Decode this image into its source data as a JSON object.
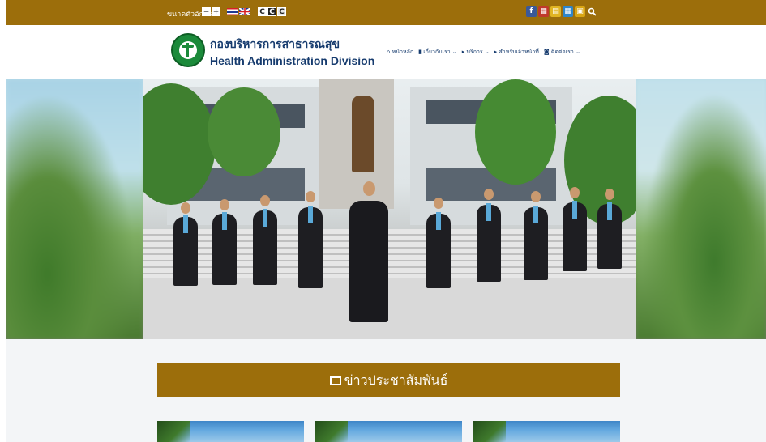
{
  "topbar": {
    "font_size_label": "ขนาดตัวอักษร",
    "font_decrease": "−",
    "font_increase": "+",
    "contrast_buttons": [
      "C",
      "C",
      "C"
    ],
    "social_icons": [
      "facebook-icon",
      "calendar-icon",
      "folder-icon",
      "grid-icon",
      "lock-icon",
      "search-icon"
    ]
  },
  "brand": {
    "title_th": "กองบริหารการสาธารณสุข",
    "title_en": "Health Administration Division"
  },
  "nav": [
    {
      "label": "หน้าหลัก",
      "icon": "home-icon"
    },
    {
      "label": "เกี่ยวกับเรา",
      "icon": "bookmark-icon",
      "dropdown": true
    },
    {
      "label": "บริการ",
      "icon": "caret-icon",
      "dropdown": true
    },
    {
      "label": "สำหรับเจ้าหน้าที่",
      "icon": "caret-icon"
    },
    {
      "label": "ติดต่อเรา",
      "icon": "chat-icon",
      "dropdown": true
    }
  ],
  "section": {
    "title": "ข่าวประชาสัมพันธ์"
  },
  "colors": {
    "brand_gold": "#9c6e0b",
    "brand_navy": "#163b6e",
    "logo_green": "#1b8a3a"
  }
}
